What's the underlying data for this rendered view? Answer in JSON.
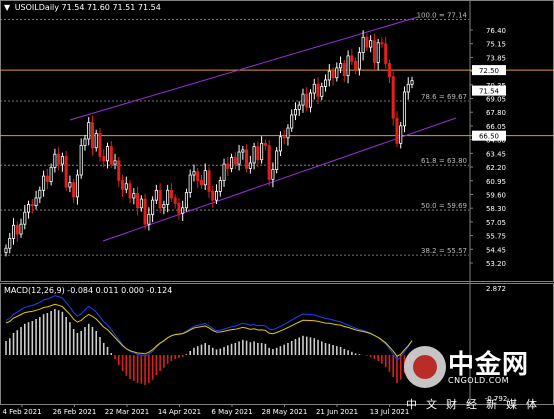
{
  "header": {
    "arrow": "▼",
    "symbol": "USOILDaily",
    "ohlc": "71.54 71.60 71.51 71.54"
  },
  "price_axis": {
    "labels": [
      "76.40",
      "75.15",
      "73.85",
      "71.54",
      "70.35",
      "69.05",
      "67.80",
      "66.05",
      "64.80",
      "63.45",
      "62.20",
      "60.95",
      "59.60",
      "58.30",
      "57.05",
      "55.75",
      "54.45",
      "53.20"
    ],
    "level_boxes": [
      {
        "value": "72.50",
        "color": "#ffffff",
        "text_color": "#000000"
      },
      {
        "value": "71.54",
        "color": "#ffffff",
        "text_color": "#000000"
      },
      {
        "value": "66.50",
        "color": "#ffffff",
        "text_color": "#000000"
      }
    ]
  },
  "fib_levels": [
    {
      "label": "100.0 = 77.14",
      "price": 77.14
    },
    {
      "label": "78.6 = 69.67",
      "price": 69.67
    },
    {
      "label": "61.8 = 63.80",
      "price": 63.8
    },
    {
      "label": "50.0 = 59.69",
      "price": 59.69
    },
    {
      "label": "38.2 = 55.57",
      "price": 55.57
    }
  ],
  "horizontal_lines": [
    {
      "price": 72.5,
      "color": "#e0a020"
    },
    {
      "price": 66.5,
      "color": "#e0a020"
    }
  ],
  "date_axis": [
    "4 Feb 2021",
    "26 Feb 2021",
    "22 Mar 2021",
    "14 Apr 2021",
    "6 May 2021",
    "28 May 2021",
    "21 Jun 2021",
    "13 Jul 2021"
  ],
  "macd": {
    "label": "MACD(12,26,9) -0.084 0.011 0.000 -0.124",
    "axis_top": "2.872",
    "axis_bottom": "-0.792"
  },
  "colors": {
    "background": "#000000",
    "bull_candle": "#ffffff",
    "bear_candle": "#e0201c",
    "channel": "#9b30d9",
    "macd_signal": "#e8c800",
    "macd_line": "#2040ff",
    "grid": "#808080"
  },
  "watermark": {
    "title": "中金网",
    "sub": "CNGOLD.COM",
    "tagline": "中文财经新媒体"
  },
  "chart_data": {
    "type": "candlestick",
    "title": "USOILDaily",
    "ylim": [
      53.2,
      78.0
    ],
    "x_labels": [
      "4 Feb 2021",
      "26 Feb 2021",
      "22 Mar 2021",
      "14 Apr 2021",
      "6 May 2021",
      "28 May 2021",
      "21 Jun 2021",
      "13 Jul 2021"
    ],
    "closes": [
      56.2,
      57.1,
      58.3,
      57.5,
      58.4,
      59.5,
      60.2,
      60.1,
      60.8,
      61.5,
      62.8,
      62.3,
      63.6,
      64.8,
      63.9,
      64.6,
      61.8,
      62.2,
      60.9,
      62.9,
      65.6,
      66.2,
      67.7,
      65.4,
      66.7,
      64.6,
      64.2,
      65.5,
      63.9,
      64.2,
      62.4,
      61.6,
      62.1,
      60.8,
      61.2,
      59.9,
      60.7,
      58.4,
      59.3,
      60.6,
      61.5,
      59.9,
      60.2,
      61.5,
      60.8,
      60.3,
      59.4,
      59.9,
      61.3,
      62.9,
      63.2,
      62.4,
      62.0,
      63.3,
      61.4,
      60.6,
      61.4,
      62.4,
      63.9,
      63.5,
      64.5,
      63.9,
      65.0,
      65.2,
      63.5,
      64.0,
      65.5,
      64.3,
      65.8,
      65.6,
      62.5,
      63.4,
      65.1,
      66.4,
      66.3,
      67.2,
      68.4,
      68.9,
      69.3,
      70.3,
      69.1,
      70.4,
      71.2,
      70.1,
      71.0,
      71.6,
      72.4,
      71.8,
      72.7,
      73.1,
      72.0,
      73.8,
      73.3,
      72.6,
      74.1,
      75.5,
      74.6,
      75.2,
      73.2,
      75.0,
      74.9,
      73.1,
      71.9,
      68.1,
      65.8,
      67.4,
      70.5,
      71.2,
      71.54
    ],
    "macd_hist": [
      0.35,
      0.42,
      0.55,
      0.62,
      0.7,
      0.78,
      0.82,
      0.85,
      0.9,
      0.95,
      1.02,
      1.05,
      1.1,
      1.15,
      1.12,
      1.08,
      0.95,
      0.82,
      0.65,
      0.55,
      0.6,
      0.7,
      0.78,
      0.7,
      0.6,
      0.45,
      0.3,
      0.2,
      0.05,
      -0.1,
      -0.25,
      -0.4,
      -0.52,
      -0.6,
      -0.65,
      -0.7,
      -0.72,
      -0.75,
      -0.7,
      -0.62,
      -0.5,
      -0.4,
      -0.32,
      -0.22,
      -0.15,
      -0.1,
      -0.08,
      -0.05,
      0.02,
      0.1,
      0.18,
      0.22,
      0.26,
      0.3,
      0.25,
      0.18,
      0.14,
      0.16,
      0.2,
      0.24,
      0.28,
      0.3,
      0.34,
      0.38,
      0.36,
      0.32,
      0.34,
      0.3,
      0.3,
      0.28,
      0.18,
      0.15,
      0.18,
      0.22,
      0.26,
      0.3,
      0.35,
      0.4,
      0.44,
      0.48,
      0.46,
      0.44,
      0.42,
      0.38,
      0.34,
      0.3,
      0.28,
      0.25,
      0.22,
      0.2,
      0.15,
      0.12,
      0.08,
      0.04,
      0.02,
      0.0,
      -0.02,
      -0.05,
      -0.1,
      -0.15,
      -0.22,
      -0.3,
      -0.42,
      -0.55,
      -0.7,
      -0.62,
      -0.45,
      -0.3,
      -0.124
    ]
  }
}
